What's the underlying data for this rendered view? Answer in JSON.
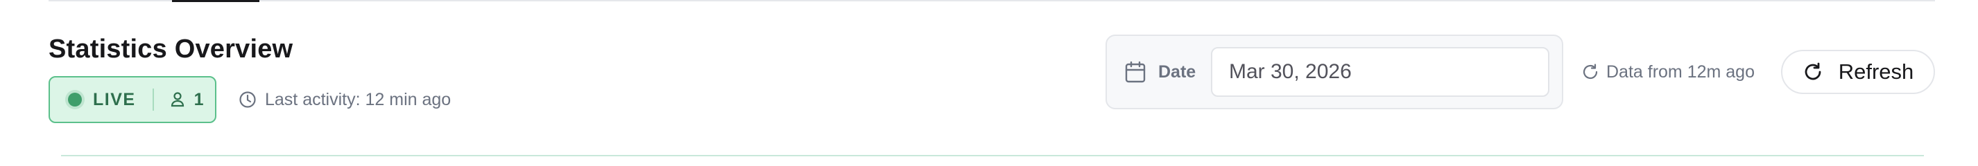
{
  "header": {
    "title": "Statistics Overview"
  },
  "status": {
    "live_label": "LIVE",
    "viewer_count": "1",
    "last_activity": "Last activity: 12 min ago"
  },
  "date_filter": {
    "label": "Date",
    "value": "Mar 30, 2026"
  },
  "data_age": "Data from 12m ago",
  "refresh": {
    "label": "Refresh"
  },
  "colors": {
    "live_green": "#3f9e6b",
    "live_bg": "#dcf5e7",
    "muted_text": "#6b7280",
    "text": "#18181b"
  },
  "icons": {
    "status": "live-dot-icon",
    "viewers": "user-icon",
    "last_activity": "clock-icon",
    "date": "calendar-icon",
    "data_age": "rotate-icon",
    "refresh": "refresh-icon"
  }
}
